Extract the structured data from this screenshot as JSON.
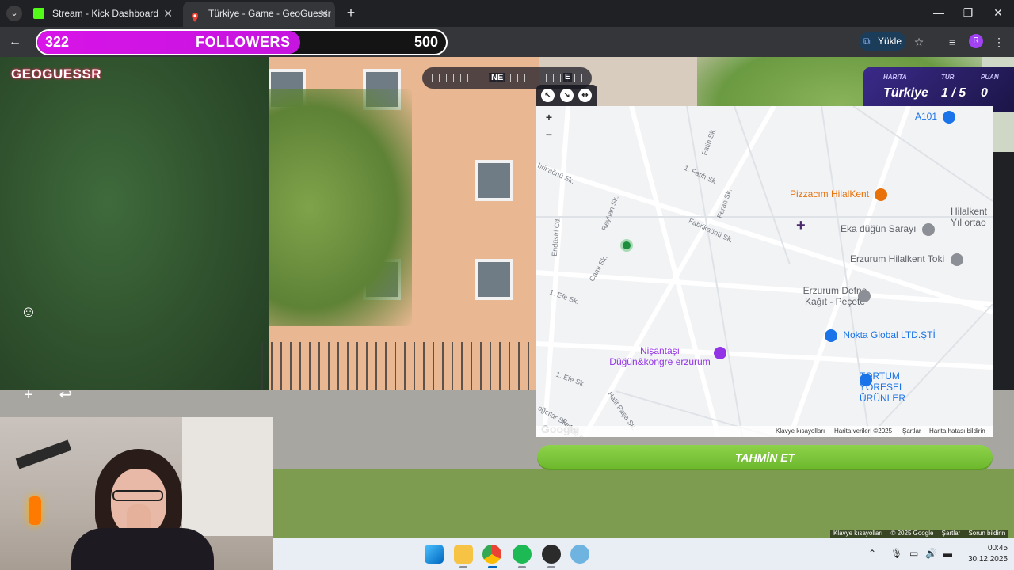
{
  "browser": {
    "tabs": [
      {
        "title": "Stream - Kick Dashboard",
        "active": false
      },
      {
        "title": "Türkiye - Game - GeoGuessr",
        "active": true
      }
    ],
    "yukle_label": "Yükle",
    "profile_initial": "R"
  },
  "followers_overlay": {
    "current": "322",
    "label": "FOLLOWERS",
    "goal": "500",
    "progress_fraction": 0.644,
    "bar_color": "#d814e8"
  },
  "game": {
    "logo": "GEOGUESSR",
    "compass": {
      "primary": "NE",
      "secondary": "E"
    },
    "status": {
      "map_label": "HARİTA",
      "map_value": "Türkiye",
      "round_label": "TUR",
      "round_value": "1 / 5",
      "score_label": "PUAN",
      "score_value": "0"
    },
    "guess_button": "TAHMİN ET",
    "street_footer": [
      "Klavye kısayolları",
      "© 2025 Google",
      "Şartlar",
      "Sorun bildirin"
    ]
  },
  "map": {
    "places": [
      {
        "name": "A101",
        "color": "#1a73e8"
      },
      {
        "name": "Pizzacım HilalKent",
        "color": "#e8710a"
      },
      {
        "name": "Hilalkent Yıl ortaо",
        "color": "#5f6368"
      },
      {
        "name": "Eka düğün Sarayı",
        "color": "#5f6368"
      },
      {
        "name": "Erzurum Hilalkent Toki",
        "color": "#5f6368"
      },
      {
        "name": "Erzurum Defne Kağıt - Peçete",
        "color": "#5f6368"
      },
      {
        "name": "Nokta Global LTD.ŞTİ",
        "color": "#1a73e8"
      },
      {
        "name": "TORTUM YÖRESEL ÜRÜNLER",
        "color": "#1a73e8"
      },
      {
        "name": "Nişantaşı Düğün&kongre erzurum",
        "color": "#9334e6"
      }
    ],
    "streets": [
      "Fatih Sk.",
      "1. Fatih Sk.",
      "Ferah Sk.",
      "Fabrikaönü Sk.",
      "brikaönü Sk.",
      "Reyhan Sk.",
      "Endüstri Cd.",
      "Cami Sk.",
      "1. Efe Sk.",
      "1. Efe Sk.",
      "Halit Paşa Sk.",
      "Fevzat P",
      "oğcılar Sk."
    ],
    "footer": [
      "Klavye kısayolları",
      "Harita verileri ©2025",
      "Şartlar",
      "Harita hatası bildirin"
    ],
    "google": "Google"
  },
  "taskbar": {
    "time": "00:45",
    "date": "30.12.2025"
  }
}
